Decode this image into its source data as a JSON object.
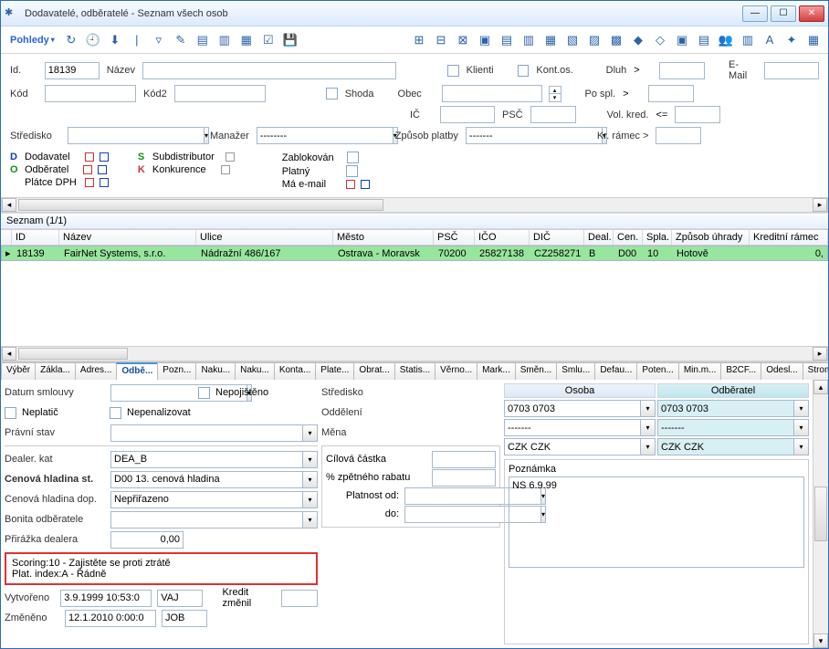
{
  "window": {
    "title": "Dodavatelé, odběratelé - Seznam všech osob"
  },
  "toolbar": {
    "views": "Pohledy"
  },
  "filters": {
    "id_label": "Id.",
    "id_value": "18139",
    "name_label": "Název",
    "klient_label": "Klienti",
    "kontos_label": "Kont.os.",
    "dluh_label": "Dluh",
    "dluh_op": ">",
    "email_label": "E-Mail",
    "kod_label": "Kód",
    "kod2_label": "Kód2",
    "shoda_label": "Shoda",
    "obec_label": "Obec",
    "pospl_label": "Po spl.",
    "pospl_op": ">",
    "ic_label": "IČ",
    "psc_label": "PSČ",
    "volkred_label": "Vol. kred.",
    "volkred_op": "<=",
    "stredisko_label": "Středisko",
    "manazer_label": "Manažer",
    "manazer_value": "--------",
    "platba_label": "Způsob platby",
    "platba_value": "-------",
    "krramec_label": "Kr. rámec >",
    "dodavatel": "Dodavatel",
    "subdist": "Subdistributor",
    "odberatel": "Odběratel",
    "konkurence": "Konkurence",
    "platcedph": "Plátce DPH",
    "zablokovan": "Zablokován",
    "platny": "Platný",
    "maemail": "Má e-mail"
  },
  "list": {
    "header": "Seznam (1/1)",
    "cols": [
      "ID",
      "Název",
      "Ulice",
      "Město",
      "PSČ",
      "IČO",
      "DIČ",
      "Deal.",
      "Cen.",
      "Spla.",
      "Způsob úhrady",
      "Kreditní rámec"
    ],
    "row": {
      "id": "18139",
      "nazev": "FairNet Systems, s.r.o.",
      "ulice": "Nádražní 486/167",
      "mesto": "Ostrava - Moravsk",
      "psc": "70200",
      "ico": "25827138",
      "dic": "CZ258271",
      "deal": "B",
      "cen": "D00",
      "spla": "10",
      "uhrada": "Hotově",
      "kredit": "0,"
    }
  },
  "tabs": [
    "Výběr",
    "Zákla...",
    "Adres...",
    "Odbě...",
    "Pozn...",
    "Naku...",
    "Naku...",
    "Konta...",
    "Plate...",
    "Obrat...",
    "Statis...",
    "Věrno...",
    "Mark...",
    "Směn...",
    "Smlu...",
    "Defau...",
    "Poten...",
    "Min.m...",
    "B2CF...",
    "Odesl...",
    "Strom..."
  ],
  "tabs_active_index": 3,
  "detail": {
    "datum_smlouvy": "Datum smlouvy",
    "nepojisteno": "Nepojištěno",
    "neplatic": "Neplatič",
    "nepenalizovat": "Nepenalizovat",
    "pravni_stav": "Právní stav",
    "dealer_kat_lbl": "Dealer. kat",
    "dealer_kat_val": "DEA_B",
    "cenova_hladina_st_lbl": "Cenová hladina st.",
    "cenova_hladina_st_val": "D00 13. cenová hladina",
    "cenova_hladina_dop_lbl": "Cenová hladina dop.",
    "cenova_hladina_dop_val": "Nepřiřazeno",
    "bonita_lbl": "Bonita odběratele",
    "prirazka_lbl": "Přirážka dealera",
    "prirazka_val": "0,00",
    "scoring": "Scoring:10 - Zajistěte se proti ztrátě",
    "plat_index": "Plat. index:A - Řádně",
    "vytvoreno_lbl": "Vytvořeno",
    "vytvoreno_dt": "3.9.1999 10:53:0",
    "vytvoreno_user": "VAJ",
    "kredit_zmenil": "Kredit změnil",
    "zmeneno_lbl": "Změněno",
    "zmeneno_dt": "12.1.2010 0:00:0",
    "zmeneno_user": "JOB",
    "stredisko_lbl": "Středisko",
    "oddeleni_lbl": "Oddělení",
    "mena_lbl": "Měna",
    "cilova_castka": "Cílová částka",
    "zpet_rabat": "% zpětného rabatu",
    "platnost_od": "Platnost od:",
    "platnost_do": "do:",
    "osoba_head": "Osoba",
    "odberatel_head": "Odběratel",
    "osoba_val": "0703 0703",
    "odberatel_val": "0703 0703",
    "osoba_dash": "-------",
    "odb_dash": "-------",
    "mena_val": "CZK CZK",
    "poznamka_lbl": "Poznámka",
    "poznamka_val": "NS 6.9.99"
  }
}
